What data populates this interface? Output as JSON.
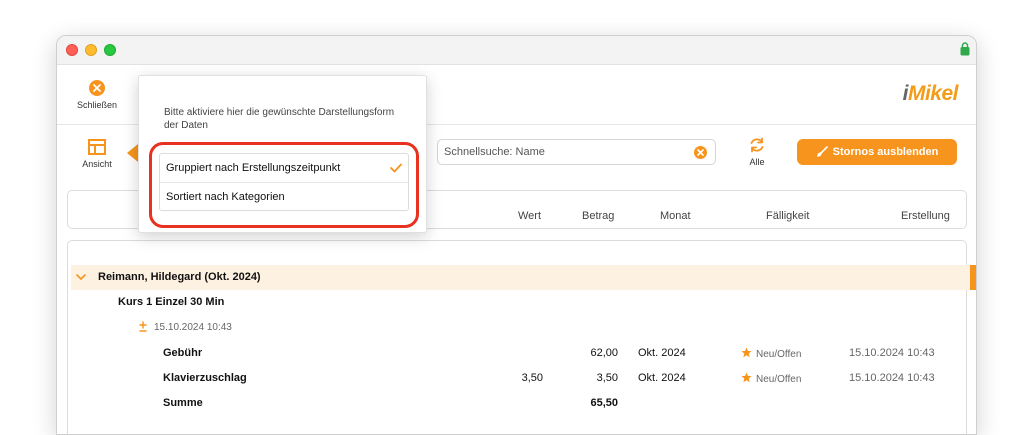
{
  "toolbar": {
    "close_label": "Schließen",
    "view_label": "Ansicht",
    "logo_i": "i",
    "logo_rest": "Mikel",
    "search_placeholder": "Schnellsuche: Name",
    "alle_label": "Alle",
    "storno_label": "Stornos ausblenden"
  },
  "popover": {
    "instruction": "Bitte aktiviere hier die gewünschte Darstellungsform der Daten",
    "options": [
      {
        "label": "Gruppiert nach Erstellungszeitpunkt",
        "selected": true
      },
      {
        "label": "Sortiert nach Kategorien",
        "selected": false
      }
    ]
  },
  "columns": {
    "wert": "Wert",
    "betrag": "Betrag",
    "monat": "Monat",
    "faelligkeit": "Fälligkeit",
    "erstellung": "Erstellung"
  },
  "group": {
    "name": "Reimann, Hildegard (Okt. 2024)",
    "course": "Kurs 1 Einzel 30 Min",
    "timestamp": "15.10.2024 10:43",
    "rows": [
      {
        "label": "Gebühr",
        "wert": "",
        "betrag": "62,00",
        "monat": "Okt. 2024",
        "status": "Neu/Offen",
        "erstellung": "15.10.2024 10:43"
      },
      {
        "label": "Klavierzuschlag",
        "wert": "3,50",
        "betrag": "3,50",
        "monat": "Okt. 2024",
        "status": "Neu/Offen",
        "erstellung": "15.10.2024 10:43"
      }
    ],
    "sum_label": "Summe",
    "sum_value": "65,50"
  },
  "colors": {
    "accent": "#f7941d",
    "highlight_ring": "#e8311e",
    "group_bg": "#fdf1e1"
  }
}
